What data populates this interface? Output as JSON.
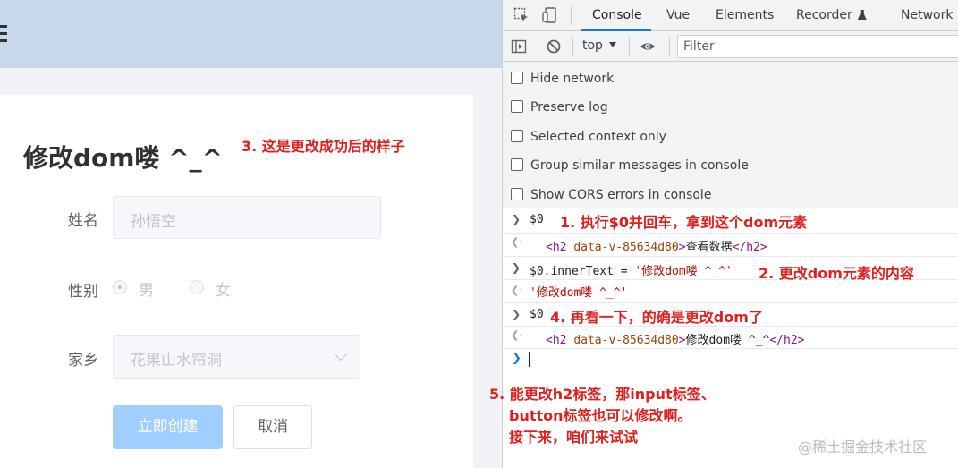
{
  "app": {
    "title": "修改dom喽 ^_^",
    "form": {
      "name_label": "姓名",
      "name_placeholder": "孙悟空",
      "gender_label": "性别",
      "gender_options": [
        "男",
        "女"
      ],
      "gender_selected": "男",
      "hometown_label": "家乡",
      "hometown_value": "花果山水帘洞",
      "create_button": "立即创建",
      "cancel_button": "取消"
    }
  },
  "devtools": {
    "tabs": [
      "Console",
      "Vue",
      "Elements",
      "Recorder",
      "Network"
    ],
    "active_tab": "Console",
    "context": "top",
    "filter_placeholder": "Filter",
    "settings": [
      {
        "label": "Hide network",
        "checked": false
      },
      {
        "label": "Preserve log",
        "checked": false
      },
      {
        "label": "Selected context only",
        "checked": false
      },
      {
        "label": "Group similar messages in console",
        "checked": false
      },
      {
        "label": "Show CORS errors in console",
        "checked": false
      }
    ],
    "console": {
      "in1": "$0",
      "out1_tag_open": "<h2",
      "out1_attr": "data-v-85634d80",
      "out1_text": "查看数据",
      "out1_tag_close": "</h2>",
      "in2_code": "$0.innerText = ",
      "in2_string": "'修改dom喽 ^_^'",
      "out2": "'修改dom喽 ^_^'",
      "in3": "$0",
      "out3_tag_open": "<h2",
      "out3_attr": "data-v-85634d80",
      "out3_text": "修改dom喽 ^_^",
      "out3_tag_close": "</h2>"
    }
  },
  "annotations": {
    "a1": "1. 执行$0并回车，拿到这个dom元素",
    "a2": "2. 更改dom元素的内容",
    "a3": "3. 这是更改成功后的样子",
    "a4": "4. 再看一下，的确是更改dom了",
    "a5_line1": "5. 能更改h2标签，那input标签、",
    "a5_line2": "button标签也可以修改啊。",
    "a5_line3": "接下来，咱们来试试"
  },
  "watermark": "@稀土掘金技术社区",
  "colors": {
    "header_bg": "#c6d8ea",
    "annotation_red": "#e0201e",
    "primary_disabled": "#a0cfff",
    "devtools_active_tab": "#1a73e8"
  }
}
